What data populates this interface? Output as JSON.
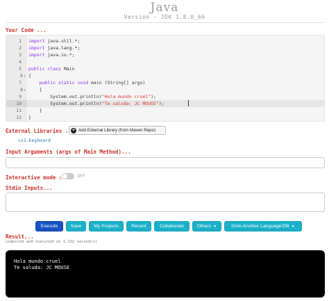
{
  "header": {
    "title": "Java",
    "version": "Version - JDK 1.8.0_66"
  },
  "editor": {
    "label": "Your Code ...",
    "lines": [
      {
        "num": "1",
        "fold": false,
        "tokens": [
          {
            "t": "kw",
            "v": "import"
          },
          {
            "t": "plain",
            "v": " java.util.*;"
          }
        ]
      },
      {
        "num": "2",
        "fold": false,
        "tokens": [
          {
            "t": "kw",
            "v": "import"
          },
          {
            "t": "plain",
            "v": " java.lang.*;"
          }
        ]
      },
      {
        "num": "3",
        "fold": false,
        "tokens": [
          {
            "t": "kw",
            "v": "import"
          },
          {
            "t": "plain",
            "v": " java.io.*;"
          }
        ]
      },
      {
        "num": "4",
        "fold": false,
        "tokens": []
      },
      {
        "num": "5",
        "fold": false,
        "tokens": [
          {
            "t": "kw",
            "v": "public class"
          },
          {
            "t": "plain",
            "v": " Main"
          }
        ]
      },
      {
        "num": "6",
        "fold": true,
        "tokens": [
          {
            "t": "plain",
            "v": "{"
          }
        ]
      },
      {
        "num": "7",
        "fold": false,
        "tokens": [
          {
            "t": "plain",
            "v": "    "
          },
          {
            "t": "kw",
            "v": "public static void"
          },
          {
            "t": "plain",
            "v": " main (String[] args)"
          }
        ]
      },
      {
        "num": "8",
        "fold": true,
        "tokens": [
          {
            "t": "plain",
            "v": "    {"
          }
        ]
      },
      {
        "num": "9",
        "fold": false,
        "tokens": [
          {
            "t": "plain",
            "v": "        System.out.println("
          },
          {
            "t": "str",
            "v": "\"Hola mundo cruel\""
          },
          {
            "t": "plain",
            "v": ");"
          }
        ]
      },
      {
        "num": "10",
        "fold": false,
        "tokens": [
          {
            "t": "plain",
            "v": "        System.out.println("
          },
          {
            "t": "str",
            "v": "\"Te saluda: JC MOUSE\""
          },
          {
            "t": "plain",
            "v": ");"
          }
        ]
      },
      {
        "num": "11",
        "fold": false,
        "tokens": [
          {
            "t": "plain",
            "v": "    }"
          }
        ]
      },
      {
        "num": "12",
        "fold": false,
        "tokens": [
          {
            "t": "plain",
            "v": "}"
          }
        ]
      }
    ],
    "active_line": 10
  },
  "libraries": {
    "label": "External Libraries ...",
    "add_button": "Add External Library (from Maven Repo)",
    "items": [
      "cs1.keyboard"
    ]
  },
  "input_args": {
    "label": "Input Arguments (args of Main Method)...",
    "value": ""
  },
  "interactive": {
    "label": "Interactive mode :",
    "state": "OFF"
  },
  "stdin": {
    "label": "Stdin Inputs...",
    "value": ""
  },
  "toolbar": {
    "execute": "Execute",
    "save": "Save",
    "my_projects": "My Projects",
    "recent": "Recent",
    "collaborate": "Collaborate",
    "others": "Others",
    "goto": "Goto Another Language/DB"
  },
  "result": {
    "label": "Result...",
    "meta": "compiled and executed in 1.132 second(s)",
    "output": [
      "Hola mundo cruel",
      "Te saluda: JC MOUSE"
    ]
  },
  "colors": {
    "primary_button": "#1652c4",
    "info_button": "#1bb0c9",
    "section_label": "#c9302c"
  }
}
